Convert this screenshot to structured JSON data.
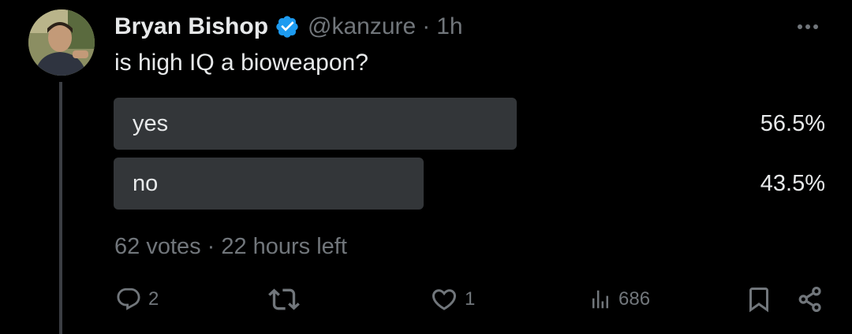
{
  "author": {
    "name": "Bryan Bishop",
    "handle": "@kanzure",
    "time": "1h",
    "separator": "·",
    "verified_icon": "verified-badge-icon",
    "verified_color": "#1d9bf0"
  },
  "tweet": {
    "text": "is high IQ a bioweapon?"
  },
  "poll": {
    "options": [
      {
        "label": "yes",
        "percent_text": "56.5%",
        "percent": 56.5
      },
      {
        "label": "no",
        "percent_text": "43.5%",
        "percent": 43.5
      }
    ],
    "votes": "62 votes",
    "separator": "·",
    "time_left": "22 hours left"
  },
  "actions": {
    "reply_count": "2",
    "retweet_count": "",
    "like_count": "1",
    "views_count": "686"
  },
  "colors": {
    "background": "#000000",
    "text": "#e7e9ea",
    "muted": "#71767b",
    "poll_fill": "#333639",
    "thread_line": "#3b3e43"
  }
}
